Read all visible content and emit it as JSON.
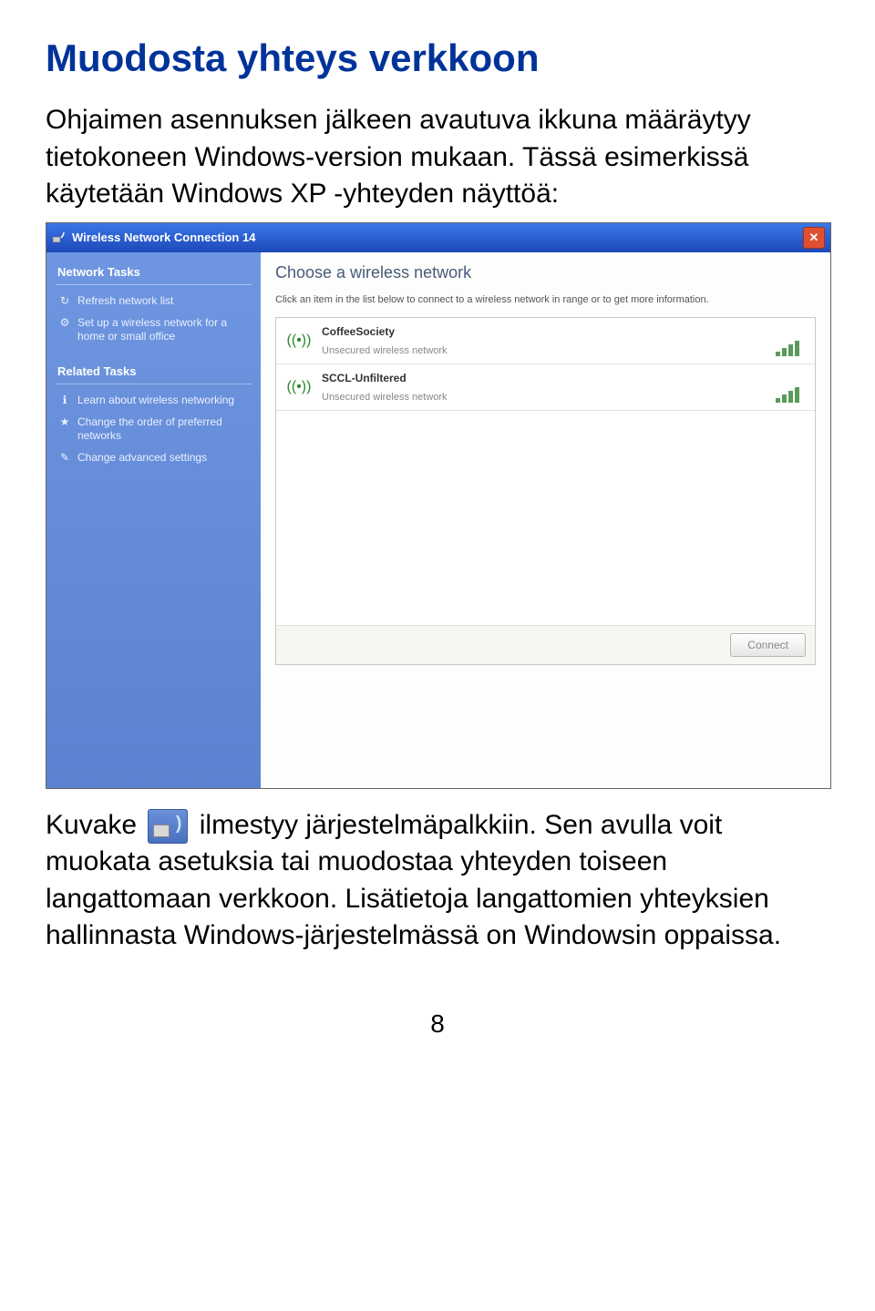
{
  "title": "Muodosta yhteys verkkoon",
  "intro": "Ohjaimen asennuksen jälkeen avautuva ikkuna määräytyy tietokoneen Windows-version mukaan. Tässä esimerkissä käytetään Windows XP -yhteyden näyttöä:",
  "screenshot": {
    "window_title": "Wireless Network Connection 14",
    "sidebar": {
      "section1_title": "Network Tasks",
      "items1": [
        {
          "icon": "↻",
          "label": "Refresh network list"
        },
        {
          "icon": "⚙",
          "label": "Set up a wireless network for a home or small office"
        }
      ],
      "section2_title": "Related Tasks",
      "items2": [
        {
          "icon": "ℹ",
          "label": "Learn about wireless networking"
        },
        {
          "icon": "★",
          "label": "Change the order of preferred networks"
        },
        {
          "icon": "✎",
          "label": "Change advanced settings"
        }
      ]
    },
    "main": {
      "heading": "Choose a wireless network",
      "helptext": "Click an item in the list below to connect to a wireless network in range or to get more information.",
      "networks": [
        {
          "name": "CoffeeSociety",
          "security": "Unsecured wireless network"
        },
        {
          "name": "SCCL-Unfiltered",
          "security": "Unsecured wireless network"
        }
      ],
      "connect_label": "Connect"
    }
  },
  "after_p1_a": "Kuvake ",
  "after_p1_b": " ilmestyy järjestelmäpalkkiin. Sen avulla voit muokata asetuksia tai muodostaa yhteyden toiseen langattomaan verkkoon. Lisätietoja langattomien yhteyksien hallinnasta Windows-järjestelmässä on Windowsin oppaissa.",
  "page_number": "8"
}
